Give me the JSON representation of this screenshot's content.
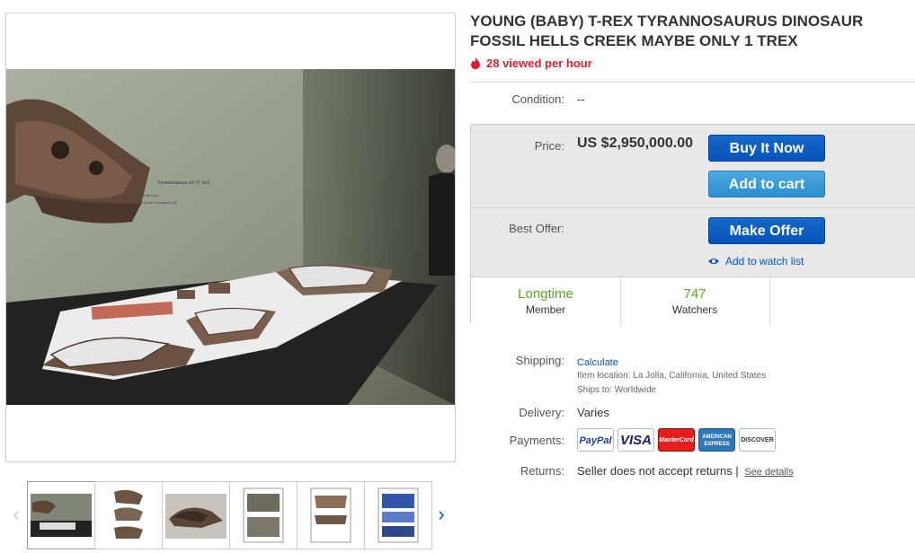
{
  "listing": {
    "title": "YOUNG (BABY) T-REX TYRANNOSAURUS DINOSAUR FOSSIL HELLS CREEK MAYBE ONLY 1 TREX",
    "views": "28 viewed per hour",
    "condition_label": "Condition:",
    "condition_value": "--"
  },
  "buy": {
    "price_label": "Price:",
    "price": "US $2,950,000.00",
    "buy_now": "Buy It Now",
    "add_to_cart": "Add to cart",
    "best_offer_label": "Best Offer:",
    "make_offer": "Make Offer",
    "watch_link": "Add to watch list"
  },
  "stats": [
    {
      "big": "Longtime",
      "small": "Member"
    },
    {
      "big": "747",
      "small": "Watchers"
    }
  ],
  "shipping": {
    "label": "Shipping:",
    "calculate": "Calculate",
    "item_location_label": "Item location:",
    "item_location": "La Jolla, California, United States",
    "ships_to_label": "Ships to:",
    "ships_to": "Worldwide"
  },
  "delivery": {
    "label": "Delivery:",
    "value": "Varies"
  },
  "payments": {
    "label": "Payments:",
    "methods": [
      "PayPal",
      "VISA",
      "MasterCard",
      "AMERICAN EXPRESS",
      "DISCOVER"
    ]
  },
  "returns": {
    "label": "Returns:",
    "value": "Seller does not accept returns |",
    "see_details": "See details"
  },
  "exhibit_sign": {
    "line1": "Tyrannosaurus rex (T. rex)",
    "line2": "Lived 66 mya",
    "line3": "Hell Creek Formation, MT"
  },
  "colors": {
    "price_button": "#0654ba",
    "cart_button": "#2b8fd1",
    "views_red": "#dd1e31",
    "stat_green": "#5ba71b"
  },
  "icons": [
    "fire-icon",
    "eye-icon",
    "chevron-left-icon",
    "chevron-right-icon"
  ]
}
